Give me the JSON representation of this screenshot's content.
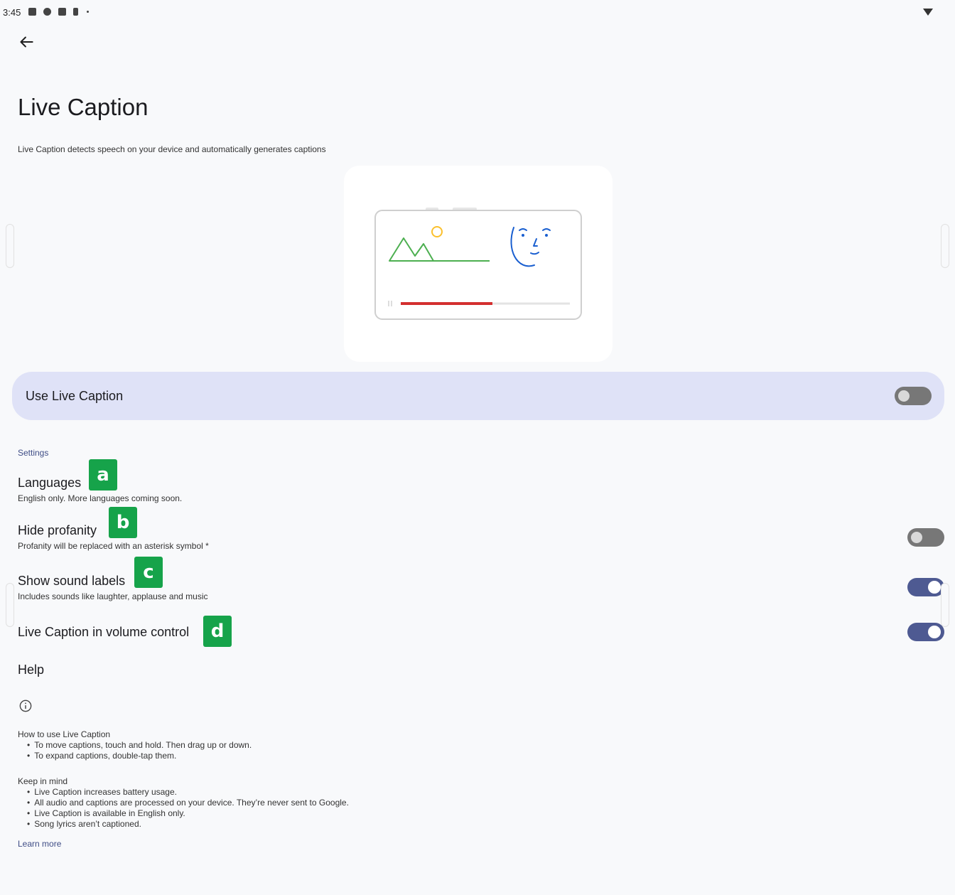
{
  "status_bar": {
    "time": "3:45"
  },
  "page": {
    "title": "Live Caption",
    "description": "Live Caption detects speech on your device and automatically generates captions"
  },
  "master_toggle": {
    "label": "Use Live Caption",
    "checked": false
  },
  "settings": {
    "header": "Settings",
    "languages": {
      "title": "Languages",
      "subtitle": "English only. More languages coming soon.",
      "badge": "a"
    },
    "hide_profanity": {
      "title": "Hide profanity",
      "subtitle": "Profanity will be replaced with an asterisk symbol *",
      "badge": "b",
      "checked": false
    },
    "sound_labels": {
      "title": "Show sound labels",
      "subtitle": "Includes sounds like laughter, applause and music",
      "badge": "c",
      "checked": true
    },
    "volume_control": {
      "title": "Live Caption in volume control",
      "badge": "d",
      "checked": true
    },
    "help": {
      "title": "Help"
    }
  },
  "footer": {
    "how_to_title": "How to use Live Caption",
    "how_to_items": [
      "To move captions, touch and hold. Then drag up or down.",
      "To expand captions, double-tap them."
    ],
    "keep_in_mind_title": "Keep in mind",
    "keep_in_mind_items": [
      "Live Caption increases battery usage.",
      "All audio and captions are processed on your device. They’re never sent to Google.",
      "Live Caption is available in English only.",
      "Song lyrics aren’t captioned."
    ],
    "learn_more": "Learn more"
  },
  "colors": {
    "accent": "#3f4d86",
    "toggle_on": "#4e5a92",
    "toggle_off": "#777777",
    "master_bg": "#dfe2f7",
    "badge": "#16a34a",
    "illus_green": "#4caf50",
    "illus_yellow": "#fbc02d",
    "illus_blue": "#1a5fd0",
    "illus_red": "#d32f2f"
  }
}
